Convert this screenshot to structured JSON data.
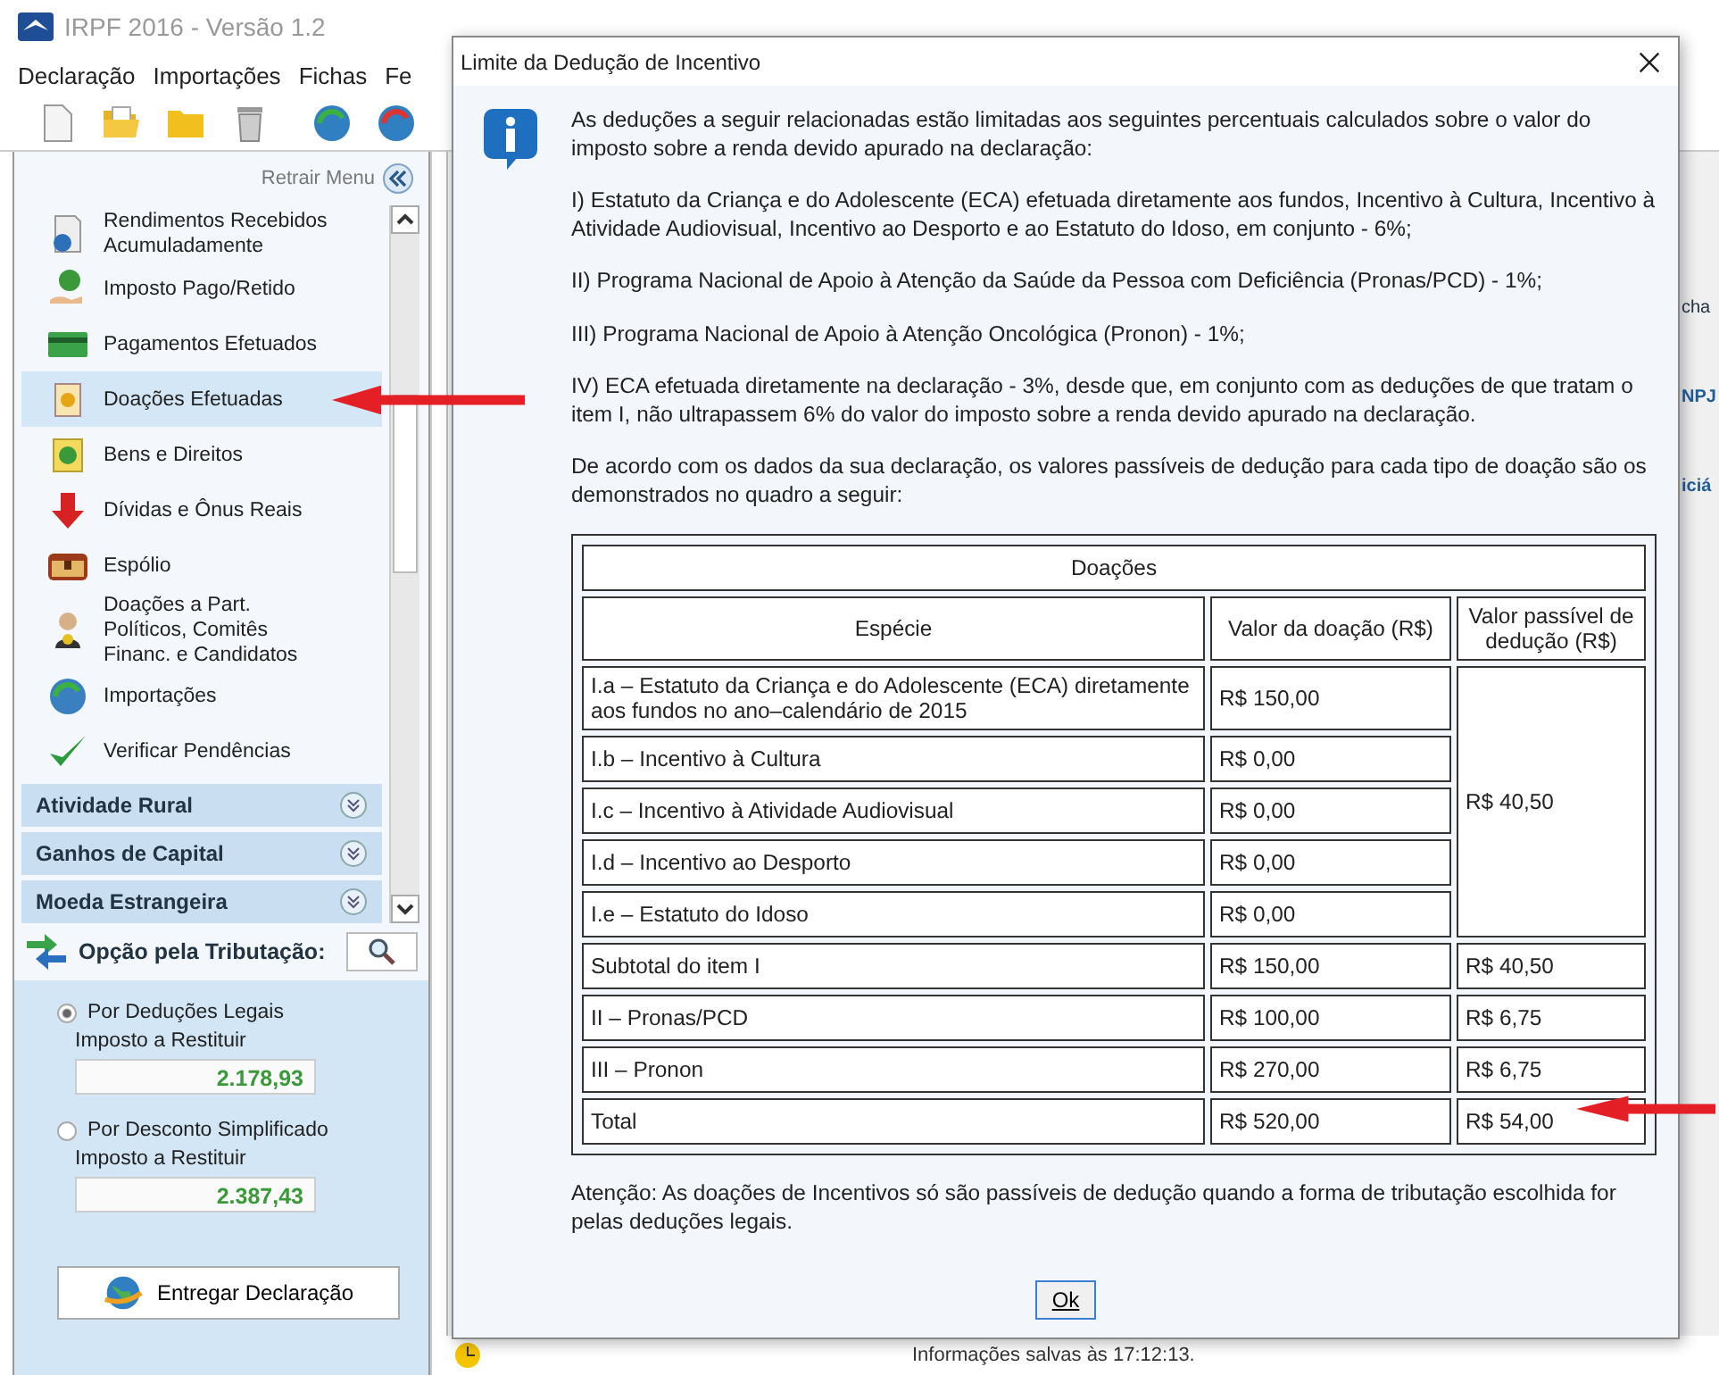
{
  "window": {
    "title": "IRPF 2016 - Versão 1.2"
  },
  "menu": [
    "Declaração",
    "Importações",
    "Fichas",
    "Fe"
  ],
  "toolbar": [
    {
      "kind": "new"
    },
    {
      "kind": "open"
    },
    {
      "kind": "folder"
    },
    {
      "kind": "trash"
    },
    {
      "kind": "sync"
    },
    {
      "kind": "sync-alt"
    }
  ],
  "sidebar": {
    "collapse_label": "Retrair Menu",
    "items": [
      {
        "label": "Rendimentos Recebidos Acumuladamente",
        "kind": "doc",
        "selected": false
      },
      {
        "label": "Imposto Pago/Retido",
        "kind": "hand",
        "selected": false
      },
      {
        "label": "Pagamentos Efetuados",
        "kind": "card",
        "selected": false
      },
      {
        "label": "Doações Efetuadas",
        "kind": "bag",
        "selected": true
      },
      {
        "label": "Bens e Direitos",
        "kind": "coin",
        "selected": false
      },
      {
        "label": "Dívidas e Ônus Reais",
        "kind": "down",
        "selected": false
      },
      {
        "label": "Espólio",
        "kind": "chest",
        "selected": false
      },
      {
        "label": "Doações a Part. Políticos, Comitês Financ. e Candidatos",
        "kind": "person",
        "selected": false
      },
      {
        "label": "Importações",
        "kind": "sync",
        "selected": false
      },
      {
        "label": "Verificar Pendências",
        "kind": "check",
        "selected": false
      }
    ],
    "sections": [
      "Atividade Rural",
      "Ganhos de Capital",
      "Moeda Estrangeira"
    ],
    "tax_option": {
      "title": "Opção pela Tributação:",
      "options": [
        {
          "label": "Por Deduções Legais",
          "selected": true,
          "field_label": "Imposto a Restituir",
          "value": "2.178,93"
        },
        {
          "label": "Por Desconto Simplificado",
          "selected": false,
          "field_label": "Imposto a Restituir",
          "value": "2.387,43"
        }
      ]
    },
    "submit_button": "Entregar Declaração"
  },
  "background_fragments": [
    "cha",
    "NPJ",
    "iciá"
  ],
  "status_bar": "Informações salvas às 17:12:13.",
  "dialog": {
    "title": "Limite da Dedução de Incentivo",
    "paragraphs": [
      "As deduções a seguir relacionadas estão limitadas aos seguintes percentuais calculados sobre o valor do imposto sobre a renda devido apurado na declaração:",
      "I) Estatuto da Criança e do Adolescente (ECA) efetuada diretamente aos fundos, Incentivo à Cultura, Incentivo à Atividade Audiovisual, Incentivo ao Desporto e ao Estatuto do Idoso, em conjunto - 6%;",
      "II) Programa Nacional de Apoio à Atenção da Saúde da Pessoa com Deficiência (Pronas/PCD) - 1%;",
      "III) Programa Nacional de Apoio à Atenção Oncológica (Pronon) - 1%;",
      "IV) ECA efetuada diretamente na declaração - 3%, desde que, em conjunto com as deduções de que tratam o item I, não ultrapassem 6% do valor do imposto sobre a renda devido apurado na declaração.",
      "De acordo com os dados da sua declaração, os valores passíveis de dedução para cada tipo de doação são os demonstrados no quadro a seguir:"
    ],
    "table": {
      "caption": "Doações",
      "columns": [
        "Espécie",
        "Valor da doação (R$)",
        "Valor passível de dedução (R$)"
      ],
      "group": {
        "deduction": "R$ 40,50",
        "rows": [
          {
            "especie": "I.a – Estatuto da Criança e do Adolescente (ECA) diretamente aos fundos no ano–calendário de 2015",
            "valor": "R$ 150,00"
          },
          {
            "especie": "I.b – Incentivo à Cultura",
            "valor": "R$ 0,00"
          },
          {
            "especie": "I.c – Incentivo à Atividade Audiovisual",
            "valor": "R$ 0,00"
          },
          {
            "especie": "I.d – Incentivo ao Desporto",
            "valor": "R$ 0,00"
          },
          {
            "especie": "I.e – Estatuto do Idoso",
            "valor": "R$ 0,00"
          }
        ]
      },
      "rows": [
        {
          "especie": "Subtotal do item I",
          "valor": "R$ 150,00",
          "deducao": "R$ 40,50"
        },
        {
          "especie": "II – Pronas/PCD",
          "valor": "R$ 100,00",
          "deducao": "R$ 6,75"
        },
        {
          "especie": "III – Pronon",
          "valor": "R$ 270,00",
          "deducao": "R$ 6,75"
        },
        {
          "especie": "Total",
          "valor": "R$ 520,00",
          "deducao": "R$ 54,00"
        }
      ]
    },
    "note": "Atenção: As doações de Incentivos só são passíveis de dedução quando a forma de tributação escolhida for pelas deduções legais.",
    "ok_button": "Ok"
  }
}
